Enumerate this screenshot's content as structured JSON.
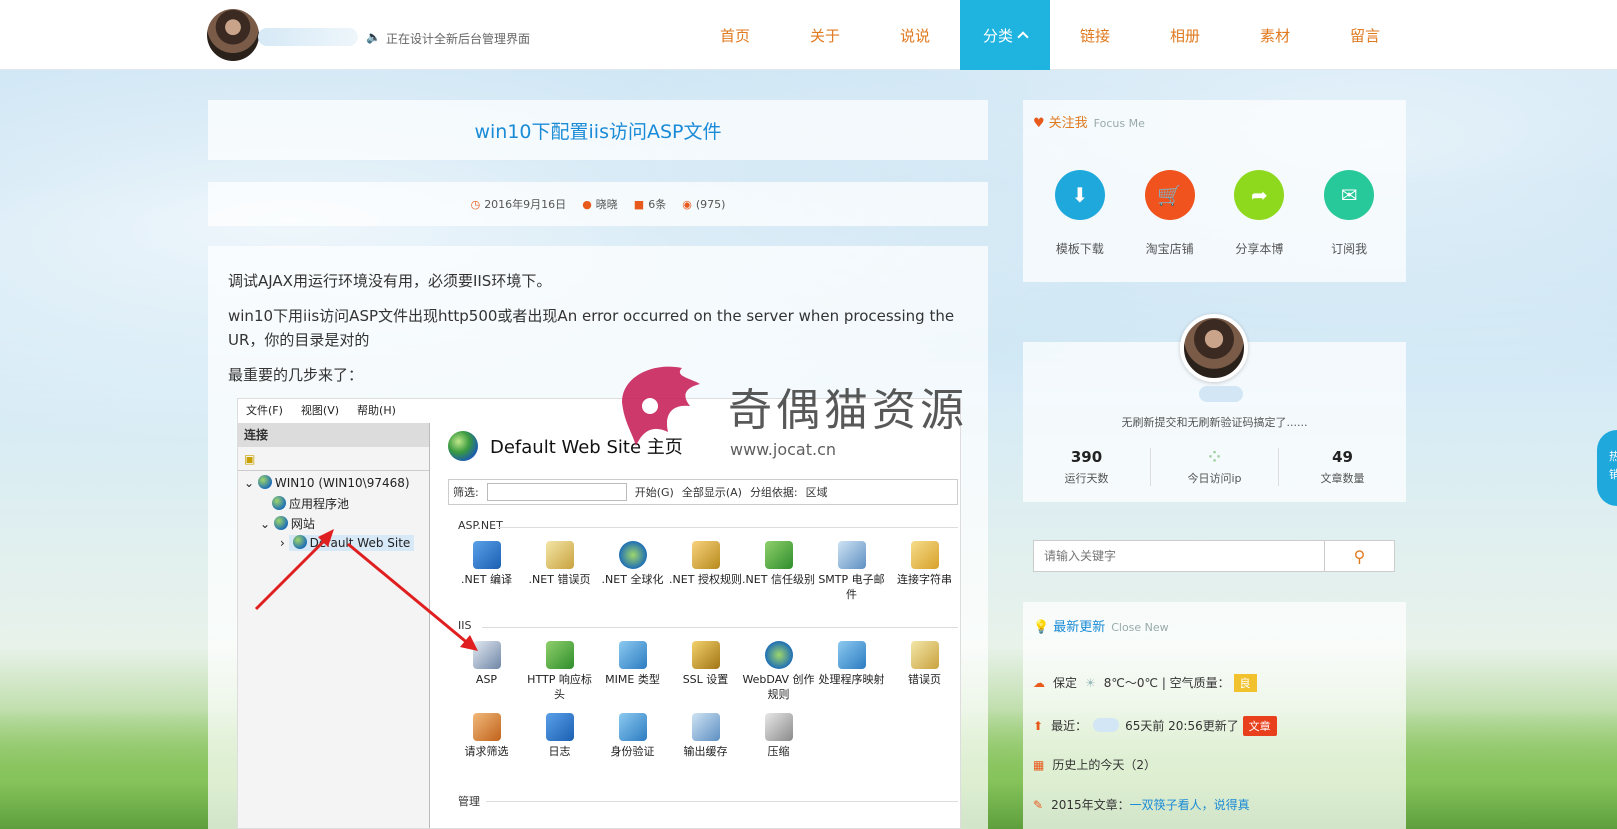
{
  "header": {
    "notice": "正在设计全新后台管理界面",
    "nav": [
      "首页",
      "关于",
      "说说",
      "分类",
      "链接",
      "相册",
      "素材",
      "留言"
    ]
  },
  "post": {
    "title": "win10下配置iis访问ASP文件",
    "date": "2016年9月16日",
    "author": "晓晓",
    "comments": "6条",
    "views": "(975)",
    "paragraphs": [
      "调试AJAX用运行环境没有用，必须要IIS环境下。",
      "win10下用iis访问ASP文件出现http500或者出现An error occurred on the server when processing the UR，你的目录是对的",
      "最重要的几步来了："
    ]
  },
  "iis": {
    "menu": [
      "文件(F)",
      "视图(V)",
      "帮助(H)"
    ],
    "left_header": "连接",
    "tree": [
      "WIN10 (WIN10\\97468)",
      "应用程序池",
      "网站",
      "Default Web Site"
    ],
    "home_title": "Default Web Site 主页",
    "filter_label": "筛选:",
    "filter_start": "开始(G)",
    "filter_showall": "全部显示(A)",
    "group_label": "分组依据:",
    "group_value": "区域",
    "sections": [
      "ASP.NET",
      "IIS",
      "管理"
    ],
    "aspnet_icons": [
      ".NET 编译",
      ".NET 错误页",
      ".NET 全球化",
      ".NET 授权规则",
      ".NET 信任级别",
      "SMTP 电子邮件",
      "连接字符串"
    ],
    "iis_icons_row1": [
      "ASP",
      "HTTP 响应标头",
      "MIME 类型",
      "SSL 设置",
      "WebDAV 创作规则",
      "处理程序映射",
      "错误页"
    ],
    "iis_icons_row2": [
      "请求筛选",
      "日志",
      "身份验证",
      "输出缓存",
      "压缩"
    ]
  },
  "watermark": {
    "cn": "奇偶猫资源",
    "url": "www.jocat.cn"
  },
  "sidebar": {
    "follow_title": "关注我",
    "follow_sub": "Focus Me",
    "follow_items": [
      "模板下载",
      "淘宝店铺",
      "分享本博",
      "订阅我"
    ],
    "profile_desc": "无刷新提交和无刷新验证码搞定了......",
    "stats": [
      {
        "num": "390",
        "label": "运行天数"
      },
      {
        "num": "",
        "label": "今日访问ip"
      },
      {
        "num": "49",
        "label": "文章数量"
      }
    ],
    "search_placeholder": "请输入关键字",
    "updates_title": "最新更新",
    "updates_sub": "Close New",
    "weather_city": "保定",
    "weather_temp": "8℃～0℃ | 空气质量：",
    "weather_badge": "良",
    "recent_prefix": "最近：",
    "recent_text": "65天前 20:56更新了",
    "recent_badge": "文章",
    "history_text": "历史上的今天（2）",
    "year_prefix": "2015年文章：",
    "year_link": "一双筷子看人，说得真"
  },
  "float_tab": [
    "热",
    "销"
  ],
  "colors": {
    "accent": "#1fb3e0",
    "orange": "#e07a1f",
    "link": "#1a8bd6"
  }
}
